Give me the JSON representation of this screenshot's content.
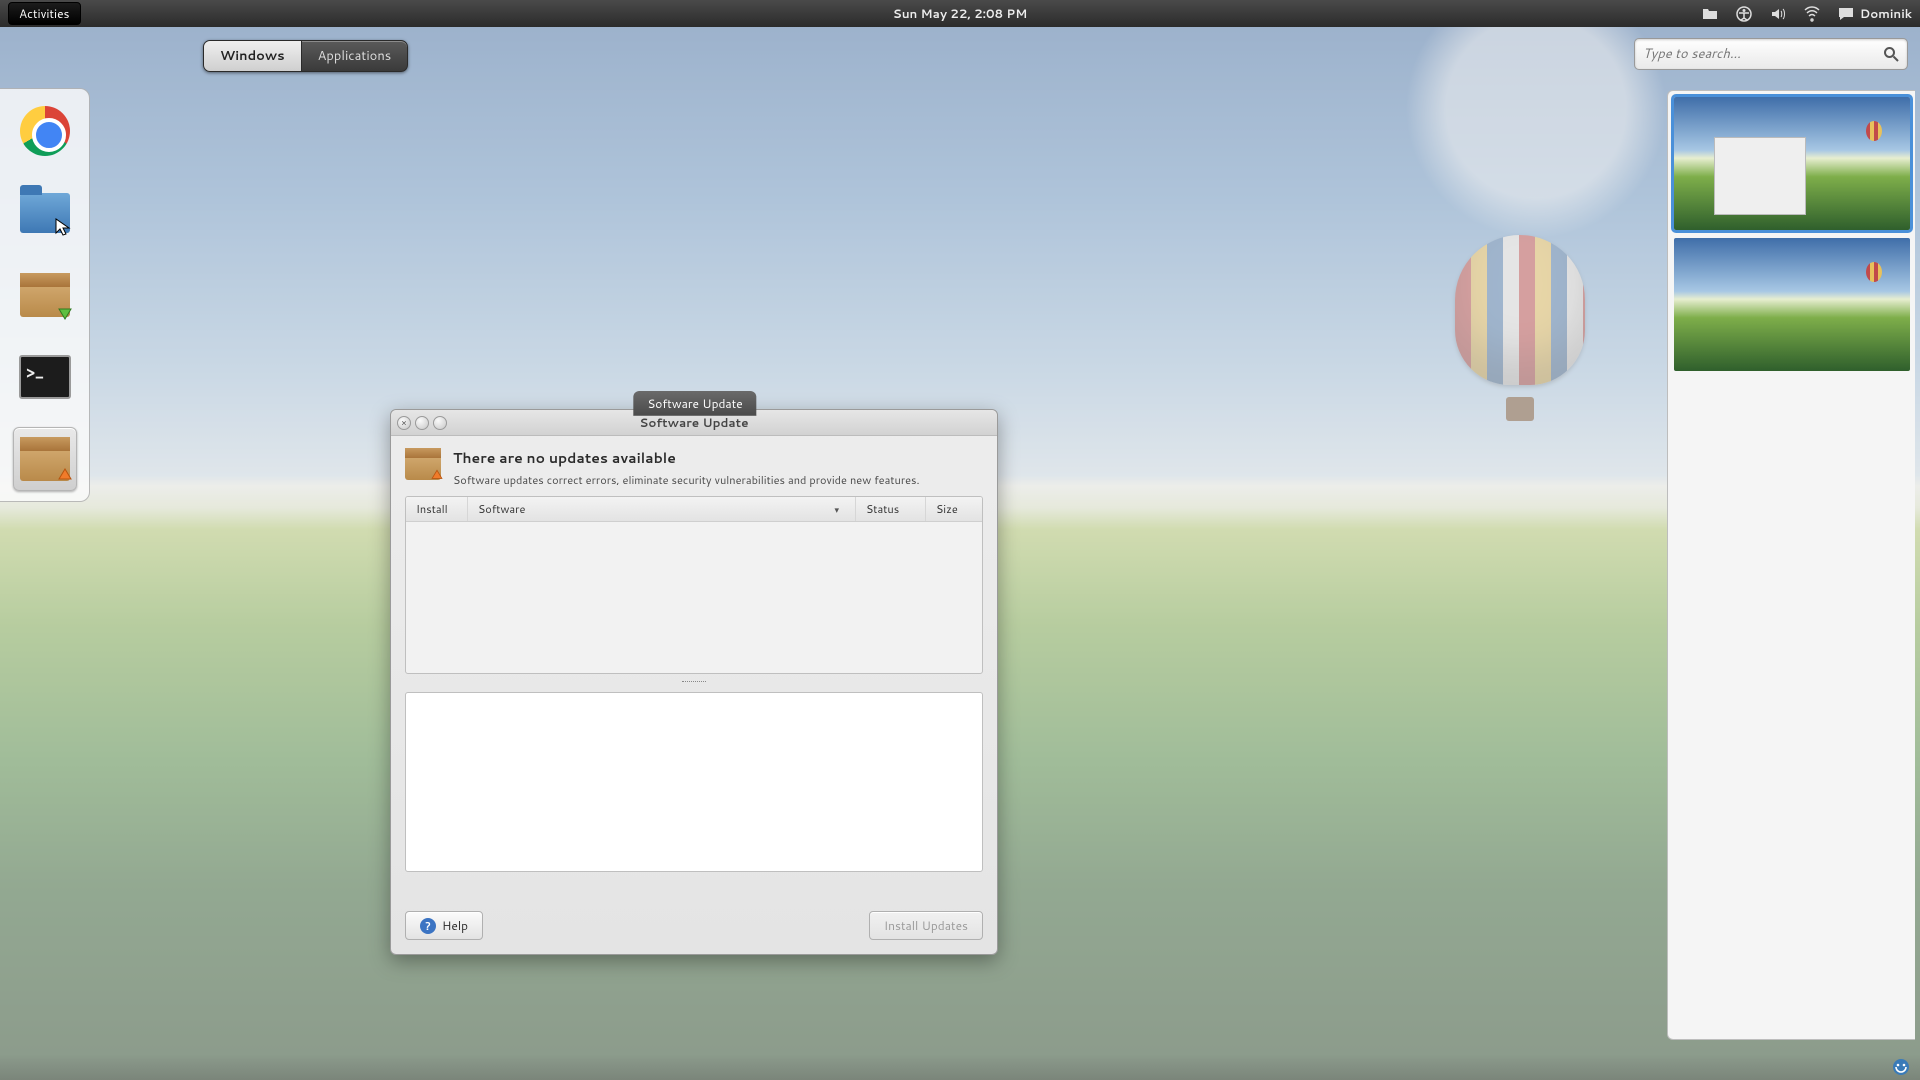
{
  "topbar": {
    "activities": "Activities",
    "clock": "Sun May 22,  2:08 PM",
    "user": "Dominik"
  },
  "overview": {
    "tab_windows": "Windows",
    "tab_apps": "Applications",
    "search_placeholder": "Type to search…"
  },
  "dash": {
    "chrome": "Google Chrome",
    "files": "Files",
    "pkginst": "Package Installer",
    "terminal": "Terminal",
    "swupdate": "Software Update",
    "term_prompt": ">_"
  },
  "window_preview_label": "Software Update",
  "su": {
    "title": "Software Update",
    "heading": "There are no updates available",
    "subheading": "Software updates correct errors, eliminate security vulnerabilities and provide new features.",
    "cols": {
      "install": "Install",
      "software": "Software",
      "status": "Status",
      "size": "Size"
    },
    "help": "Help",
    "install": "Install Updates"
  },
  "icons": {
    "folder": "folder-icon",
    "volume": "volume-icon",
    "a11y": "accessibility-icon",
    "network": "network-icon",
    "chat": "chat-icon",
    "search": "search-icon",
    "close": "close-icon",
    "minimize": "minimize-icon",
    "maximize": "maximize-icon",
    "help": "help-icon",
    "cursor": "cursor-icon",
    "arrow_down": "arrow-down-icon",
    "arrow_up": "arrow-up-icon",
    "tray": "tray-app-icon"
  }
}
